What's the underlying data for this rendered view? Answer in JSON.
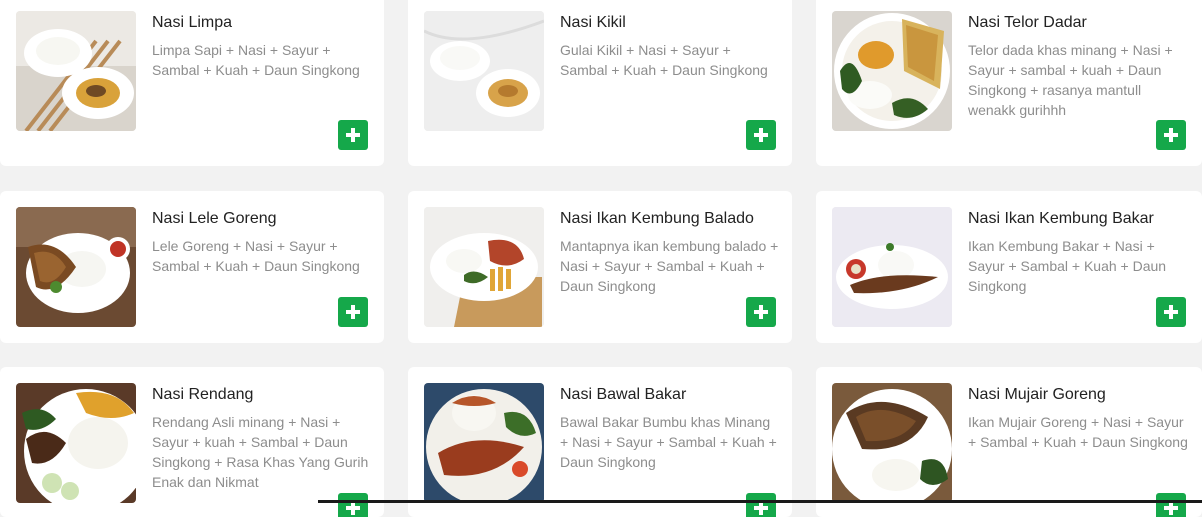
{
  "menu": {
    "items": [
      {
        "name": "Nasi Limpa",
        "description": "Limpa Sapi + Nasi + Sayur + Sambal + Kuah + Daun Singkong",
        "image_icon": "food-photo-icon"
      },
      {
        "name": "Nasi Kikil",
        "description": "Gulai Kikil + Nasi + Sayur + Sambal + Kuah + Daun Singkong",
        "image_icon": "food-photo-icon"
      },
      {
        "name": "Nasi Telor Dadar",
        "description": "Telor dada khas minang + Nasi + Sayur + sambal + kuah + Daun Singkong + rasanya mantull wenakk gurihhh",
        "image_icon": "food-photo-icon"
      },
      {
        "name": "Nasi Lele Goreng",
        "description": "Lele Goreng + Nasi + Sayur + Sambal + Kuah + Daun Singkong",
        "image_icon": "food-photo-icon"
      },
      {
        "name": "Nasi Ikan Kembung Balado",
        "description": "Mantapnya ikan kembung balado + Nasi + Sayur + Sambal + Kuah + Daun Singkong",
        "image_icon": "food-photo-icon"
      },
      {
        "name": "Nasi Ikan Kembung Bakar",
        "description": "Ikan Kembung Bakar + Nasi + Sayur + Sambal + Kuah + Daun Singkong",
        "image_icon": "food-photo-icon"
      },
      {
        "name": "Nasi Rendang",
        "description": "Rendang Asli minang + Nasi + Sayur + kuah + Sambal + Daun Singkong + Rasa Khas Yang Gurih Enak dan Nikmat",
        "image_icon": "food-photo-icon"
      },
      {
        "name": "Nasi Bawal Bakar",
        "description": "Bawal Bakar Bumbu khas Minang + Nasi + Sayur + Sambal + Kuah + Daun Singkong",
        "image_icon": "food-photo-icon"
      },
      {
        "name": "Nasi Mujair Goreng",
        "description": "Ikan Mujair Goreng + Nasi + Sayur + Sambal + Kuah + Daun Singkong",
        "image_icon": "food-photo-icon"
      }
    ]
  },
  "colors": {
    "background": "#f2f2f2",
    "card": "#ffffff",
    "title": "#222222",
    "description": "#8d8d8d",
    "add_button": "#15a84a"
  },
  "icons": {
    "add": "plus-icon"
  }
}
